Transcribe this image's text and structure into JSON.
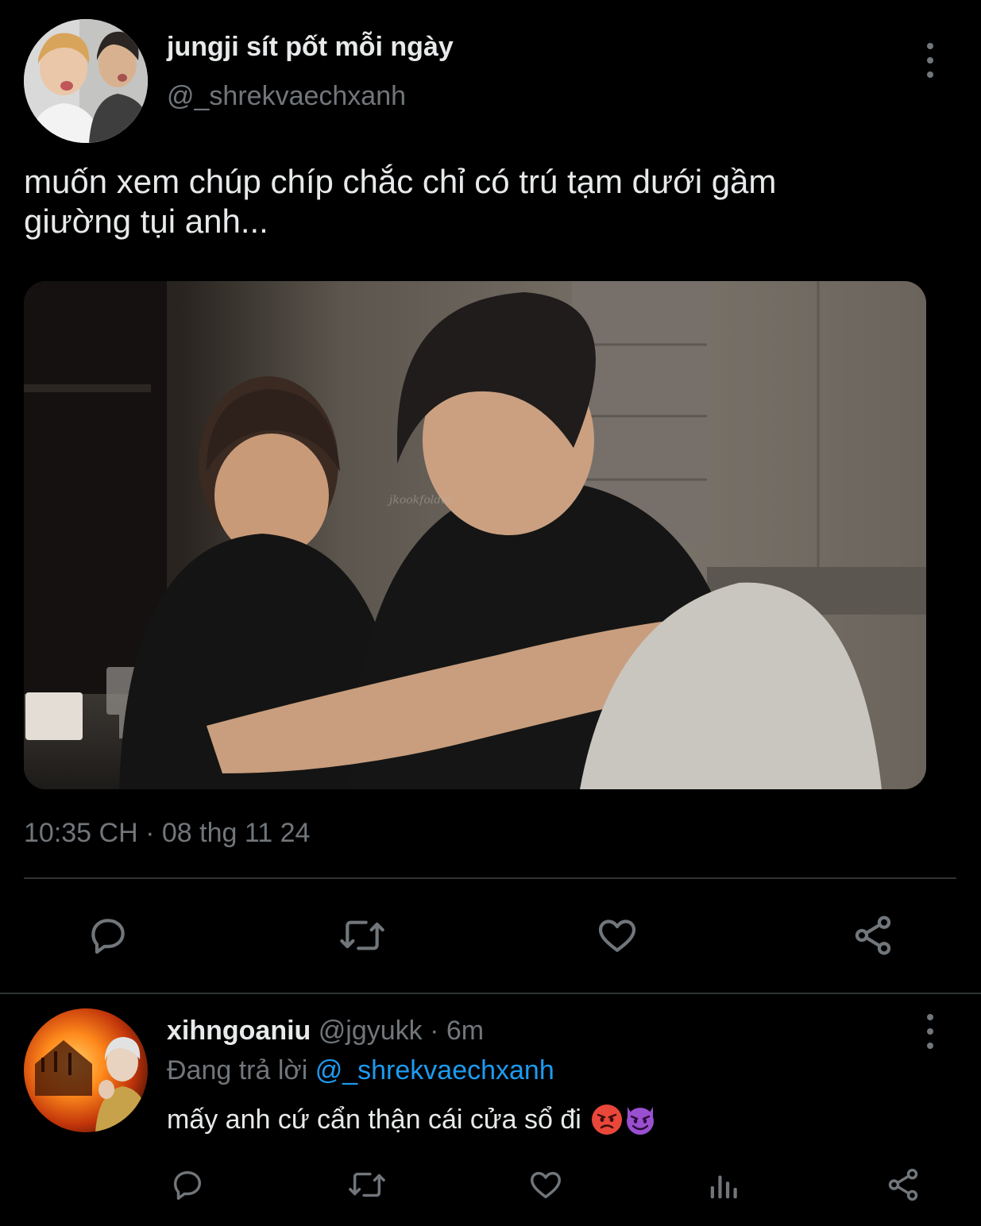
{
  "tweet": {
    "display_name": "jungji sít pốt mỗi ngày",
    "handle": "@_shrekvaechxanh",
    "text_line1": "muốn xem chúp chíp chắc chỉ có trú tạm dưới gầm",
    "text_line2": "giường tụi anh...",
    "timestamp": "10:35 CH · 08 thg 11 24",
    "photo_watermark": "jkookfolder",
    "actions": [
      "reply-icon",
      "retweet-icon",
      "like-icon",
      "share-icon"
    ]
  },
  "reply": {
    "display_name": "xihngoaniu",
    "handle": "@jgyukk",
    "time": "· 6m",
    "replying_prefix": "Đang trả lời",
    "replying_to": "@_shrekvaechxanh",
    "text": "mấy anh cứ cẩn thận cái cửa sổ đi",
    "emojis": [
      "angry-face-emoji",
      "smiling-devil-emoji"
    ],
    "actions": [
      "reply-icon",
      "retweet-icon",
      "like-icon",
      "views-icon",
      "share-icon"
    ]
  },
  "colors": {
    "background": "#000000",
    "text": "#e7e9ea",
    "muted": "#71767b",
    "accent": "#1d9bf0",
    "divider": "#2f3336"
  }
}
